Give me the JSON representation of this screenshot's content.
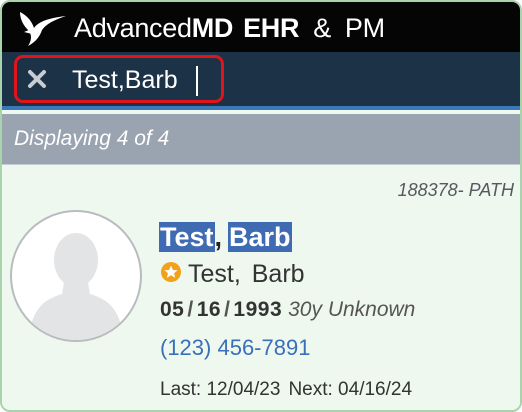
{
  "header": {
    "brand_advanced": "Advanced",
    "brand_md": "MD",
    "brand_ehr": "EHR",
    "brand_amp": "&",
    "brand_pm": "PM",
    "logo_icon": "hummingbird-logo-icon"
  },
  "search": {
    "value": "Test,Barb",
    "clear_icon": "close-icon"
  },
  "results": {
    "displaying_text": "Displaying 4 of 4"
  },
  "patient": {
    "account": "188378- PATH",
    "last_name": "Test",
    "comma": ",",
    "first_name": "Barb",
    "alias": "Test, Barb",
    "dob_month": "05",
    "dob_day": "16",
    "dob_year": "1993",
    "dob_sep1": "/",
    "dob_sep2": "/",
    "age_sex": "30y Unknown",
    "phone": "(123) 456-7891",
    "last_visit": "Last: 12/04/23",
    "next_visit": "Next: 04/16/24",
    "avatar_icon": "person-silhouette-icon",
    "star_icon": "star-badge-icon"
  },
  "colors": {
    "header_bg": "#050505",
    "search_bg": "#1c3347",
    "search_accent": "#3a78b8",
    "search_outline": "#e0141a",
    "display_bar_bg": "#9aa3b0",
    "card_bg": "#eef8ef",
    "highlight": "#3f6bb3",
    "phone": "#3a6fb9",
    "star": "#f2a21a"
  }
}
